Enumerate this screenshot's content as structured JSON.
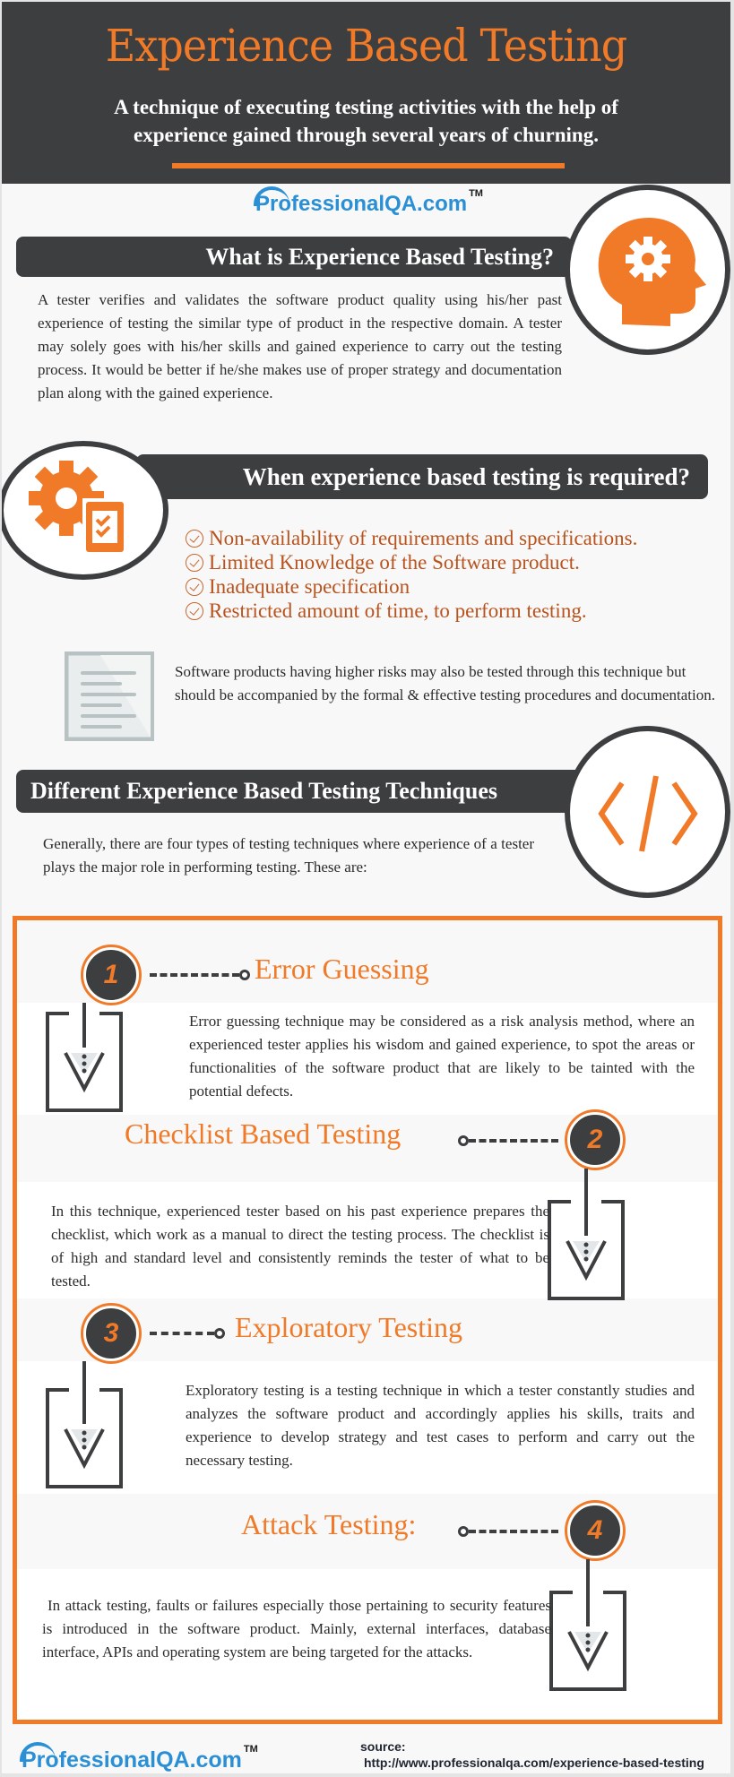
{
  "header": {
    "title": "Experience Based Testing",
    "subtitle_line1": "A technique of executing testing activities with the help of",
    "subtitle_line2": "experience gained through several years of churning."
  },
  "logo": {
    "brand": "Professional",
    "brand_suffix": "QA.com",
    "trademark": "TM"
  },
  "what_is": {
    "heading": "What is  Experience Based Testing?",
    "icon": "head-gear-icon",
    "body": "A tester verifies and validates the software product quality using his/her past experience of testing the similar type of product in the respective domain. A tester may solely goes with his/her skills and gained experience to carry out the testing process.  It would be better if he/she makes use of proper strategy and documentation plan along with the gained experience."
  },
  "when_required": {
    "heading": "When experience based testing is required?",
    "icon": "gear-checklist-icon",
    "items": [
      "Non-availability of requirements and specifications.",
      "Limited Knowledge of the Software product.",
      "Inadequate specification",
      "Restricted amount of time, to perform testing."
    ],
    "note_icon": "document-icon",
    "note": "Software products having higher risks may also be tested through this technique but should be accompanied by the formal & effective testing procedures and documentation."
  },
  "techniques": {
    "heading": "Different Experience Based Testing Techniques",
    "icon": "code-icon",
    "intro": "Generally, there are four types of testing techniques where experience of a tester plays the major role in performing testing. These are:",
    "items": [
      {
        "number": "1",
        "title": "Error Guessing",
        "body": "Error guessing technique may be considered as a risk analysis method, where an experienced tester applies his wisdom and gained experience, to spot the areas or functionalities of the software product that are likely to be tainted with the potential defects."
      },
      {
        "number": "2",
        "title": "Checklist Based Testing",
        "body": "In this technique, experienced tester based on his past experience prepares the checklist, which work as a manual to direct the testing process. The checklist is of high and standard level and consistently reminds the tester of what to be tested."
      },
      {
        "number": "3",
        "title": "Exploratory Testing",
        "body": "Exploratory testing is a testing technique in which a tester constantly studies and analyzes the software product and accordingly applies his skills, traits and experience to develop strategy and test cases to perform and carry out the necessary testing."
      },
      {
        "number": "4",
        "title": "Attack Testing:",
        "body": "In attack testing, faults or failures especially those pertaining to security features is introduced in the software product. Mainly, external interfaces, database interface, APIs and operating system are being targeted for the attacks."
      }
    ]
  },
  "footer": {
    "source_label": "source:",
    "source_url": "http://www.professionalqa.com/experience-based-testing"
  },
  "colors": {
    "accent": "#f07a28",
    "dark": "#3c3e40",
    "list_text": "#b8531e",
    "logo_blue": "#2a8fd4"
  }
}
